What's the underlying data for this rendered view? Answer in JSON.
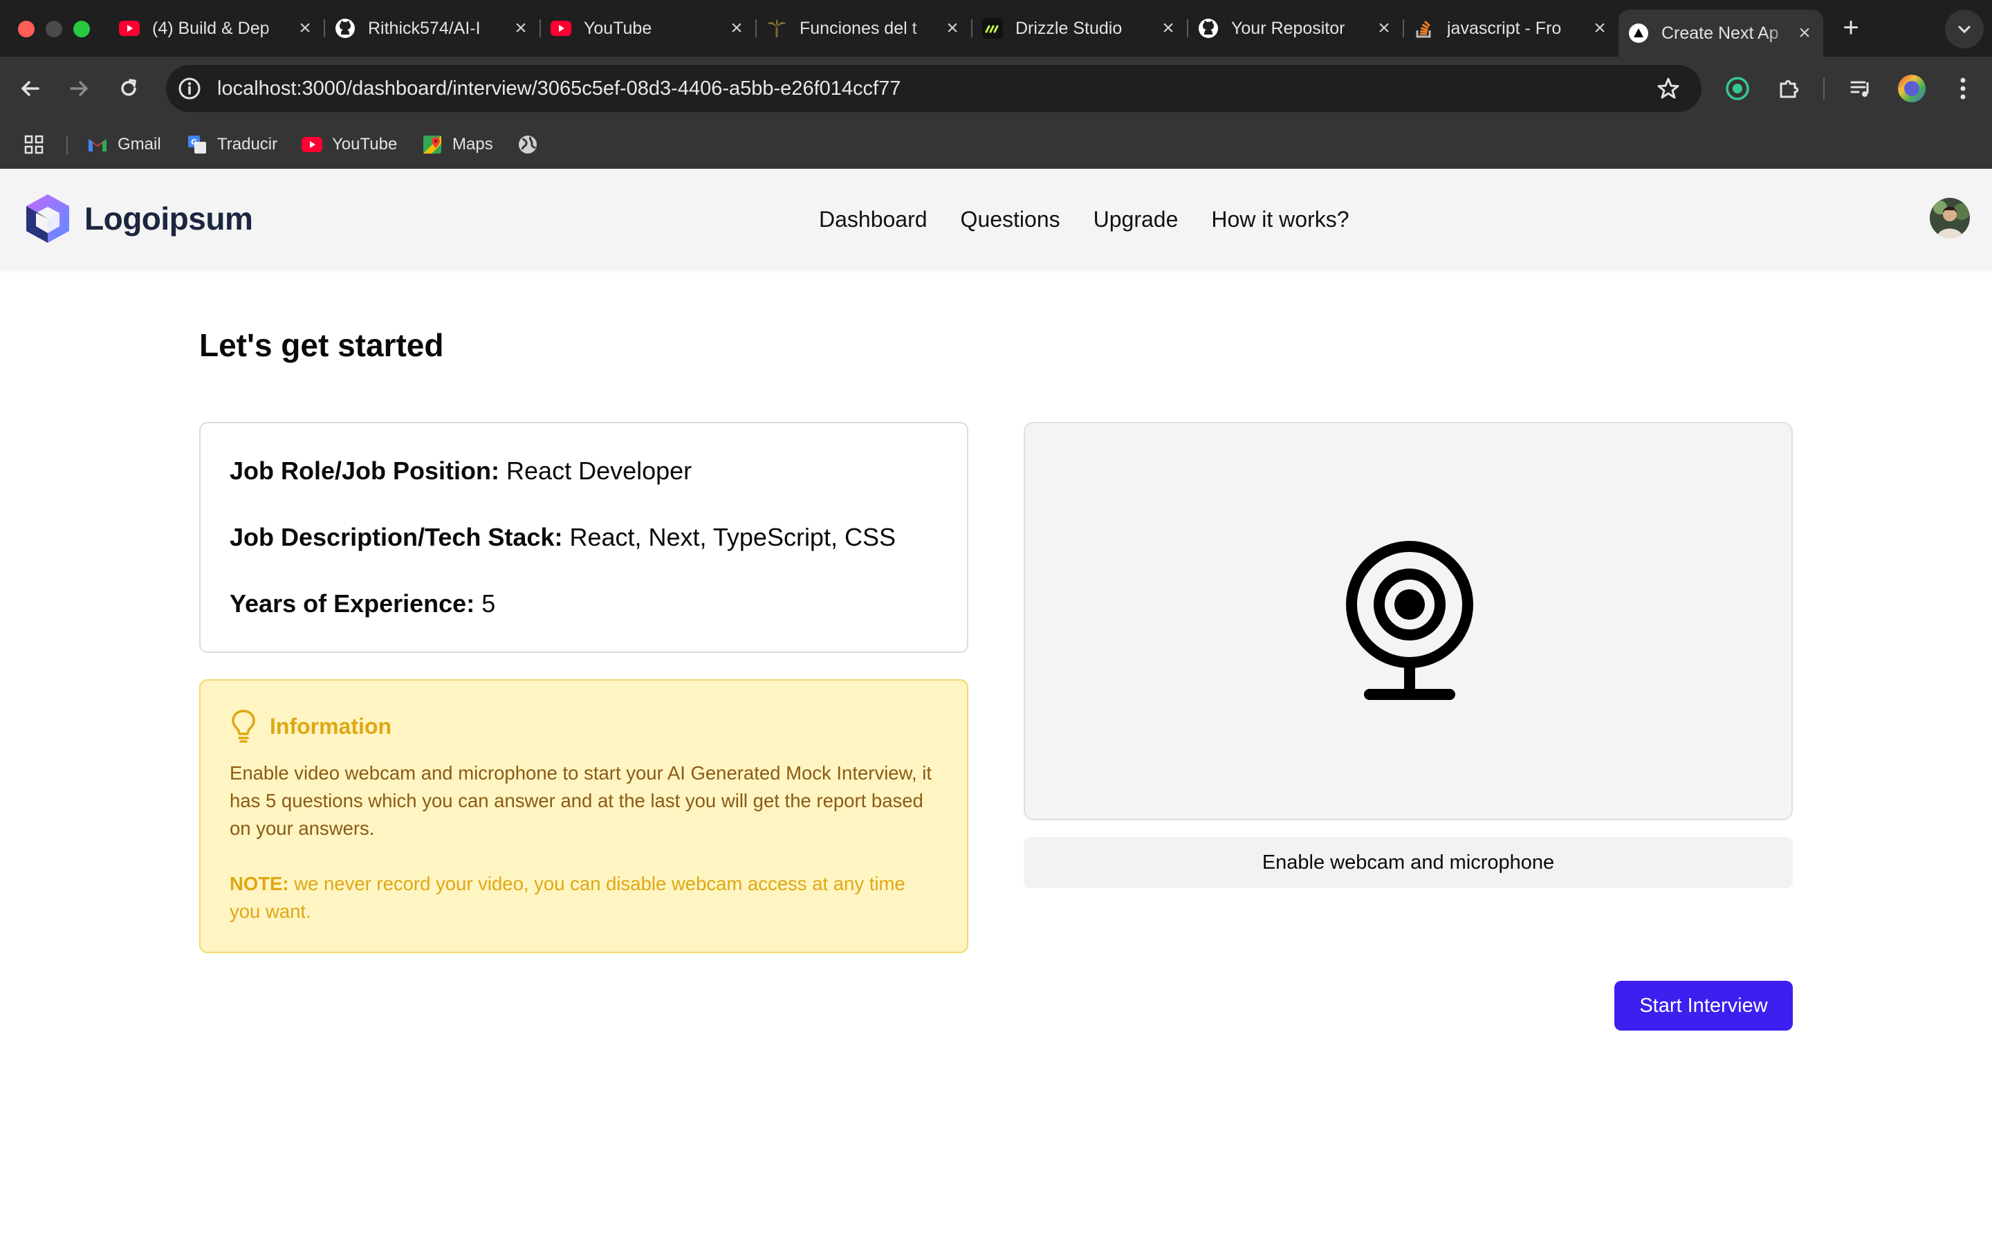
{
  "browser": {
    "tabs": [
      {
        "title": "(4) Build & Dep",
        "favicon": "youtube-icon"
      },
      {
        "title": "Rithick574/AI-I",
        "favicon": "github-icon"
      },
      {
        "title": "YouTube",
        "favicon": "youtube-icon"
      },
      {
        "title": "Funciones del t",
        "favicon": "plant-icon"
      },
      {
        "title": "Drizzle Studio",
        "favicon": "drizzle-icon"
      },
      {
        "title": "Your Repositor",
        "favicon": "github-icon"
      },
      {
        "title": "javascript - Fro",
        "favicon": "stackoverflow-icon"
      },
      {
        "title": "Create Next Ap",
        "favicon": "nextjs-icon",
        "active": true
      }
    ],
    "url": "localhost:3000/dashboard/interview/3065c5ef-08d3-4406-a5bb-e26f014ccf77",
    "bookmarks": [
      {
        "label": "Gmail",
        "icon": "gmail-icon"
      },
      {
        "label": "Traducir",
        "icon": "translate-icon"
      },
      {
        "label": "YouTube",
        "icon": "youtube-icon"
      },
      {
        "label": "Maps",
        "icon": "maps-icon"
      },
      {
        "label": "",
        "icon": "globe-icon"
      }
    ]
  },
  "app": {
    "logo_text": "Logoipsum",
    "nav": [
      "Dashboard",
      "Questions",
      "Upgrade",
      "How it works?"
    ],
    "page_title": "Let's get started",
    "job": {
      "role_label": "Job Role/Job Position:",
      "role_value": "React Developer",
      "desc_label": "Job Description/Tech Stack:",
      "desc_value": "React, Next, TypeScript, CSS",
      "exp_label": "Years of Experience:",
      "exp_value": "5"
    },
    "info": {
      "title": "Information",
      "body": "Enable video webcam and microphone to start your AI Generated Mock Interview, it has 5 questions which you can answer and at the last you will get the report based on your answers.",
      "note_label": "NOTE:",
      "note_text": "we never record your video, you can disable webcam access at any time you want."
    },
    "enable_button": "Enable webcam and microphone",
    "start_button": "Start Interview"
  },
  "colors": {
    "accent": "#3d1fef",
    "info_bg": "#fef5c2",
    "info_title": "#e0a714",
    "info_text": "#8c5a14"
  }
}
